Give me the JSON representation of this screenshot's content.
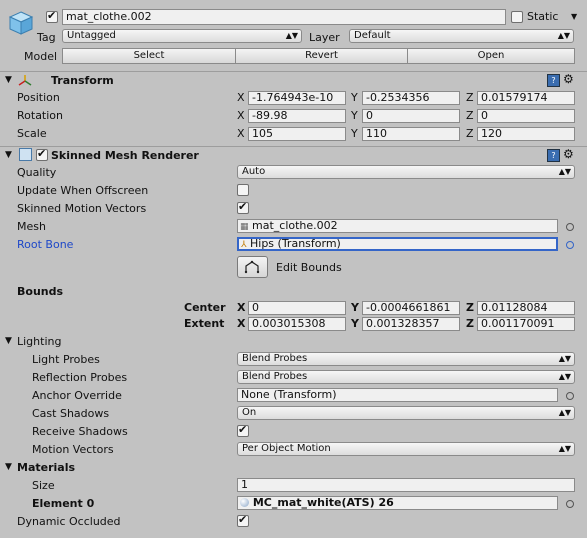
{
  "object": {
    "name": "mat_clothe.002",
    "static_label": "Static",
    "tag_label": "Tag",
    "tag_value": "Untagged",
    "layer_label": "Layer",
    "layer_value": "Default",
    "model_label": "Model",
    "select_label": "Select",
    "revert_label": "Revert",
    "open_label": "Open"
  },
  "transform": {
    "title": "Transform",
    "position_label": "Position",
    "rotation_label": "Rotation",
    "scale_label": "Scale",
    "x": "X",
    "y": "Y",
    "z": "Z",
    "position": {
      "x": "-1.764943e-10",
      "y": "-0.2534356",
      "z": "0.01579174"
    },
    "rotation": {
      "x": "-89.98",
      "y": "0",
      "z": "0"
    },
    "scale": {
      "x": "105",
      "y": "110",
      "z": "120"
    }
  },
  "smr": {
    "title": "Skinned Mesh Renderer",
    "quality_label": "Quality",
    "quality_value": "Auto",
    "update_offscreen_label": "Update When Offscreen",
    "skinned_motion_label": "Skinned Motion Vectors",
    "mesh_label": "Mesh",
    "mesh_value": "mat_clothe.002",
    "root_bone_label": "Root Bone",
    "root_bone_value": "Hips (Transform)",
    "edit_bounds_label": "Edit Bounds",
    "bounds_label": "Bounds",
    "center_label": "Center",
    "extent_label": "Extent",
    "center": {
      "x": "0",
      "y": "-0.0004661861",
      "z": "0.01128084"
    },
    "extent": {
      "x": "0.003015308",
      "y": "0.001328357",
      "z": "0.001170091"
    },
    "lighting_label": "Lighting",
    "light_probes_label": "Light Probes",
    "light_probes_value": "Blend Probes",
    "reflection_probes_label": "Reflection Probes",
    "reflection_probes_value": "Blend Probes",
    "anchor_override_label": "Anchor Override",
    "anchor_override_value": "None (Transform)",
    "cast_shadows_label": "Cast Shadows",
    "cast_shadows_value": "On",
    "receive_shadows_label": "Receive Shadows",
    "motion_vectors_label": "Motion Vectors",
    "motion_vectors_value": "Per Object Motion",
    "materials_label": "Materials",
    "size_label": "Size",
    "size_value": "1",
    "element0_label": "Element 0",
    "element0_value": "MC_mat_white(ATS) 26",
    "dynamic_occluded_label": "Dynamic Occluded"
  }
}
